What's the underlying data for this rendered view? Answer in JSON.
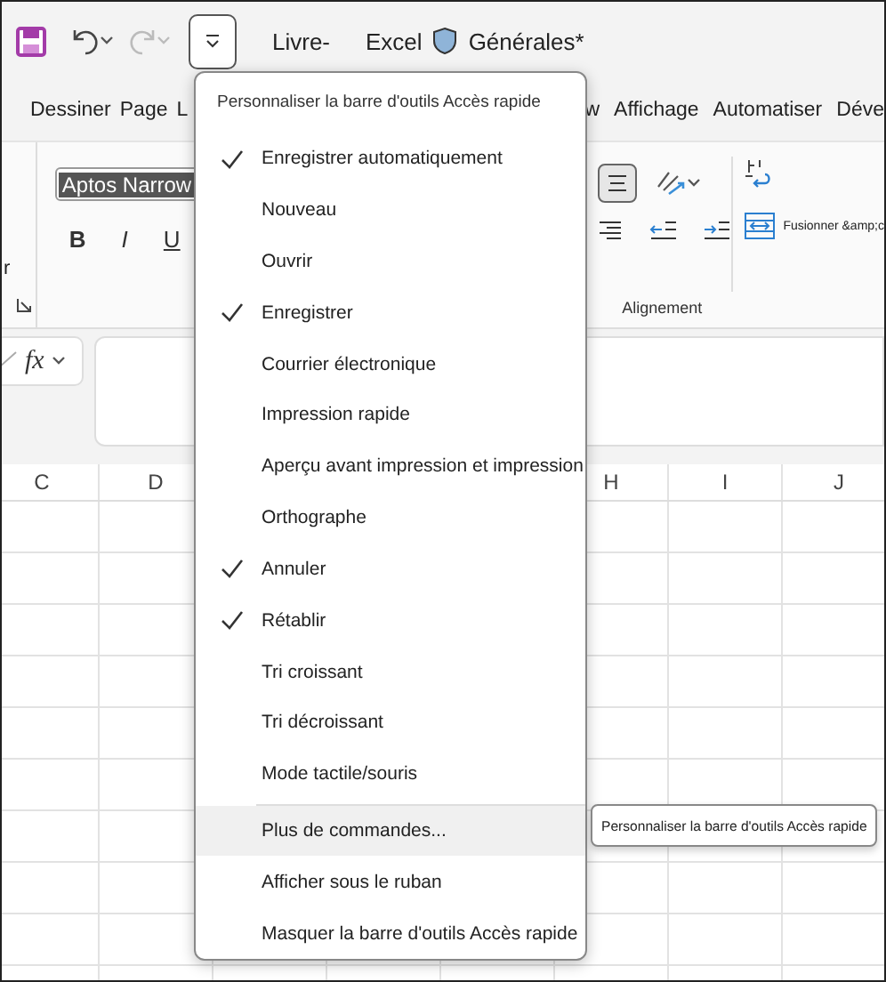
{
  "title_bar": {
    "quick_access_button": {
      "expanded": true
    },
    "redo_disabled": true,
    "texts": [
      "Livre-",
      "Excel"
    ],
    "sensitivity_label": "Générales*"
  },
  "ribbon_tabs": {
    "left": [
      "Dessiner",
      "Page",
      "L"
    ],
    "right": [
      "w",
      "Affichage",
      "Automatiser",
      "Déve"
    ]
  },
  "ribbon": {
    "cut_label": "r",
    "font_field": {
      "value": "Aptos Narrow"
    },
    "format_buttons": [
      "B",
      "I",
      "U"
    ],
    "alignment": {
      "middle_align_selected": true,
      "merge_label": "Fusionner &amp;c",
      "group_label": "Alignement"
    }
  },
  "formula_bar": {
    "function_label": "fx"
  },
  "columns": [
    {
      "label": "C"
    },
    {
      "label": "D"
    },
    {
      "label": "H"
    },
    {
      "label": "I"
    },
    {
      "label": "J"
    }
  ],
  "menu": {
    "title": "Personnaliser la barre d'outils Accès rapide",
    "options": [
      {
        "label": "Enregistrer automatiquement",
        "checked": true
      },
      {
        "label": "Nouveau",
        "checked": false
      },
      {
        "label": "Ouvrir",
        "checked": false
      },
      {
        "label": "Enregistrer",
        "checked": true
      },
      {
        "label": "Courrier électronique",
        "checked": false
      },
      {
        "label": "Impression rapide",
        "checked": false
      },
      {
        "label": "Aperçu avant impression et impression",
        "checked": false
      },
      {
        "label": "Orthographe",
        "checked": false
      },
      {
        "label": "Annuler",
        "checked": true
      },
      {
        "label": "Rétablir",
        "checked": true
      },
      {
        "label": "Tri croissant",
        "checked": false
      },
      {
        "label": "Tri décroissant",
        "checked": false
      },
      {
        "label": "Mode tactile/souris",
        "checked": false
      }
    ],
    "commands": [
      {
        "label": "Plus de commandes...",
        "selected": true
      },
      {
        "label": "Afficher sous le ruban",
        "selected": false
      },
      {
        "label": "Masquer la barre d'outils Accès rapide",
        "selected": false
      }
    ]
  },
  "tooltip": {
    "text": "Personnaliser la barre d'outils Accès rapide"
  }
}
